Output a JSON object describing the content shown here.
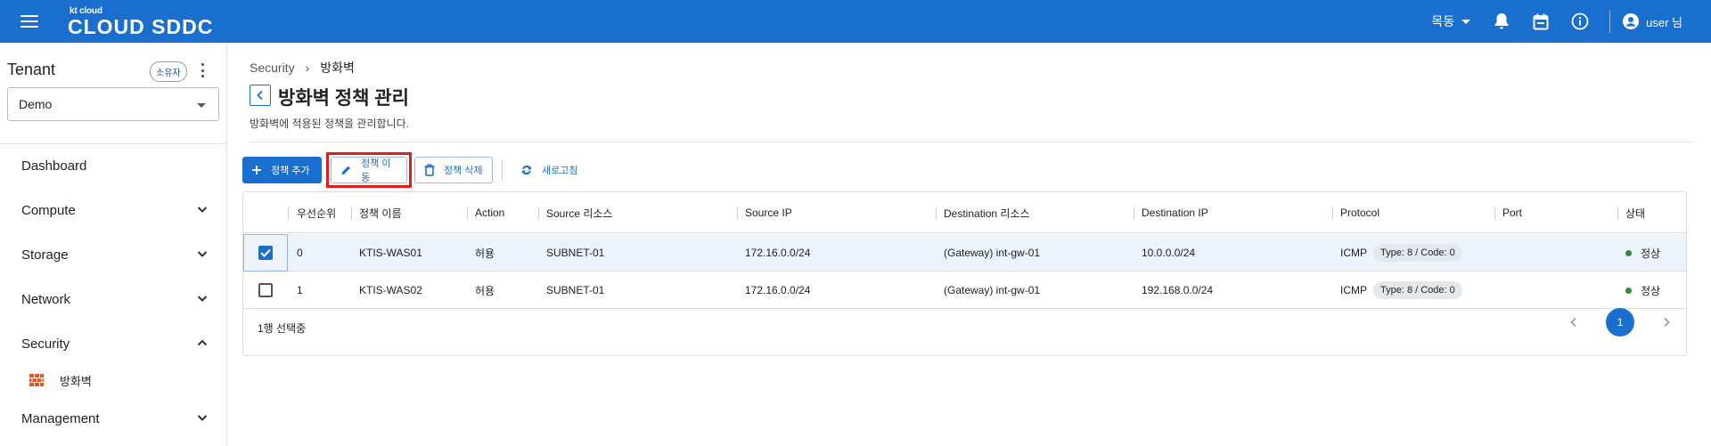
{
  "header": {
    "logo_small": "kt cloud",
    "logo_big": "CLOUD SDDC",
    "region": "목동",
    "user_name": "user 님",
    "icons": [
      "menu-icon",
      "bell-icon",
      "calendar-icon",
      "info-icon",
      "account-icon"
    ],
    "brand_color": "#1a6fce"
  },
  "sidebar": {
    "tenant_title": "Tenant",
    "owner_badge": "소유자",
    "tenant_value": "Demo",
    "nav": [
      {
        "label": "Dashboard"
      },
      {
        "label": "Compute",
        "expanded": false
      },
      {
        "label": "Storage",
        "expanded": false
      },
      {
        "label": "Network",
        "expanded": false
      },
      {
        "label": "Security",
        "expanded": true
      },
      {
        "label": "Management",
        "expanded": false
      }
    ],
    "security_sub": {
      "label": "방화벽",
      "icon": "firewall-icon"
    }
  },
  "breadcrumb": {
    "parent": "Security",
    "current": "방화벽"
  },
  "page": {
    "title": "방화벽 정책 관리",
    "description": "방화벽에 적용된 정책을 관리합니다."
  },
  "toolbar": {
    "add_label": "정책 추가",
    "move_label": "정책 이동",
    "delete_label": "정책 삭제",
    "refresh_label": "새로고침",
    "highlight_color": "#e31b1b"
  },
  "table": {
    "columns": [
      "우선순위",
      "정책 이름",
      "Action",
      "Source 리소스",
      "Source IP",
      "Destination 리소스",
      "Destination IP",
      "Protocol",
      "Port",
      "상태"
    ],
    "rows": [
      {
        "selected": true,
        "priority": "0",
        "name": "KTIS-WAS01",
        "action": "허용",
        "source_resource": "SUBNET-01",
        "source_ip": "172.16.0.0/24",
        "dest_resource": "(Gateway) int-gw-01",
        "dest_ip": "10.0.0.0/24",
        "protocol": "ICMP",
        "protocol_detail": "Type: 8 / Code: 0",
        "port": "",
        "status": "정상"
      },
      {
        "selected": false,
        "priority": "1",
        "name": "KTIS-WAS02",
        "action": "허용",
        "source_resource": "SUBNET-01",
        "source_ip": "172.16.0.0/24",
        "dest_resource": "(Gateway) int-gw-01",
        "dest_ip": "192.168.0.0/24",
        "protocol": "ICMP",
        "protocol_detail": "Type: 8 / Code: 0",
        "port": "",
        "status": "정상"
      }
    ],
    "selection_text": "1행 선택중",
    "pagination": {
      "current_page": "1"
    },
    "status_color": "#2e8b2e"
  }
}
